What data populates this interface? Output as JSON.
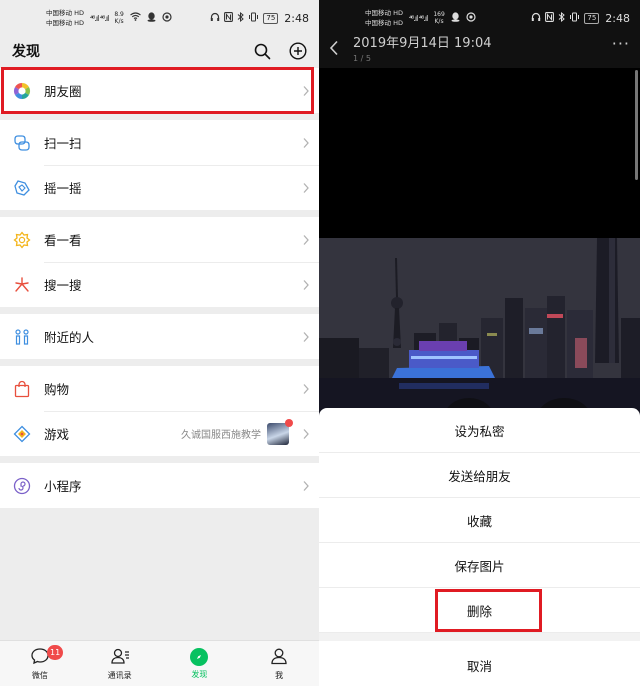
{
  "left_status": {
    "carrier1": "中国移动 HD",
    "carrier2": "中国移动 HD",
    "signal": "⁴⁶.ıl ⁴⁶.ıl",
    "speed_value": "8.9",
    "speed_unit": "K/s",
    "battery": "75",
    "time": "2:48"
  },
  "right_status": {
    "carrier1": "中国移动 HD",
    "carrier2": "中国移动 HD",
    "signal": "⁴⁶.ıl ⁴⁶.ıl",
    "speed_value": "169",
    "speed_unit": "K/s",
    "battery": "75",
    "time": "2:48"
  },
  "discover": {
    "title": "发现",
    "groups": [
      [
        {
          "label": "朋友圈",
          "icon": "moments-icon"
        }
      ],
      [
        {
          "label": "扫一扫",
          "icon": "scan-icon"
        },
        {
          "label": "摇一摇",
          "icon": "shake-icon"
        }
      ],
      [
        {
          "label": "看一看",
          "icon": "top-stories-icon"
        },
        {
          "label": "搜一搜",
          "icon": "search-star-icon"
        }
      ],
      [
        {
          "label": "附近的人",
          "icon": "people-nearby-icon"
        }
      ],
      [
        {
          "label": "购物",
          "icon": "shopping-bag-icon"
        },
        {
          "label": "游戏",
          "icon": "games-icon",
          "extra": "久诚国服西施教学"
        }
      ],
      [
        {
          "label": "小程序",
          "icon": "mini-programs-icon"
        }
      ]
    ]
  },
  "bottom_nav": [
    {
      "label": "微信",
      "icon": "chat-icon",
      "badge": "11"
    },
    {
      "label": "通讯录",
      "icon": "contacts-icon"
    },
    {
      "label": "发现",
      "icon": "discover-icon",
      "active": true
    },
    {
      "label": "我",
      "icon": "me-icon"
    }
  ],
  "viewer": {
    "datetime": "2019年9月14日 19:04",
    "pager": "1 / 5"
  },
  "action_sheet": {
    "items": [
      "设为私密",
      "发送给朋友",
      "收藏",
      "保存图片",
      "删除"
    ],
    "cancel": "取消"
  },
  "colors": {
    "accent": "#07c160",
    "highlight": "#e01b23",
    "badge": "#f04a4a"
  }
}
